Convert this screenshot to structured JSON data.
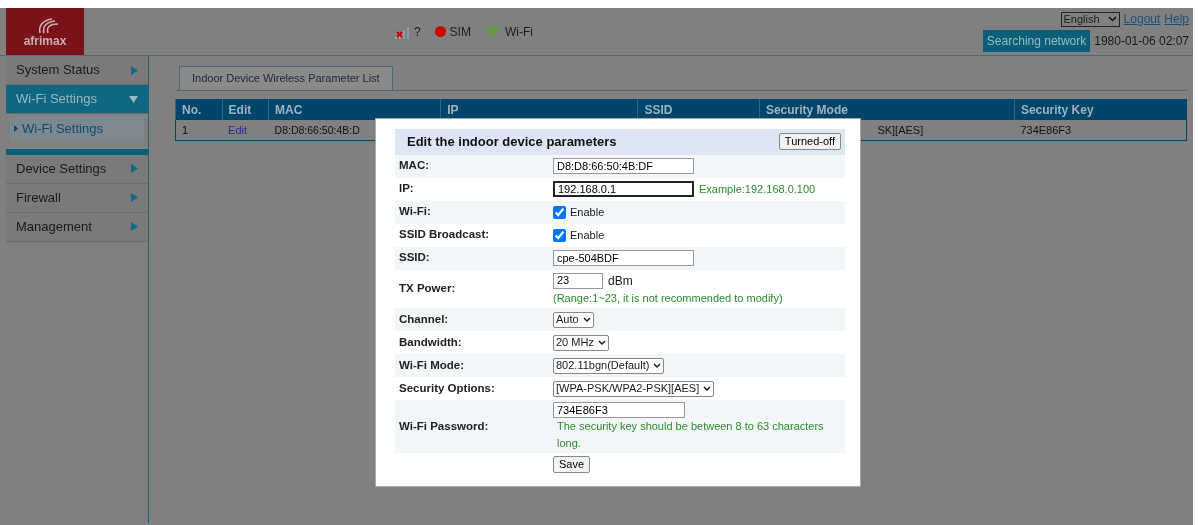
{
  "header": {
    "logo": "afrimax",
    "signal": {
      "text": "?"
    },
    "sim": {
      "text": "SIM",
      "color": "#cc0000"
    },
    "wifi": {
      "text": "Wi-Fi",
      "color": "#4caf1a"
    },
    "language": "English",
    "links": [
      "Logout",
      "Help"
    ],
    "network_status": "Searching network",
    "datetime": "1980-01-06 02:07"
  },
  "sidebar": {
    "items": [
      {
        "label": "System Status",
        "expanded": false,
        "selected": false
      },
      {
        "label": "Wi-Fi Settings",
        "expanded": true,
        "selected": true,
        "children": [
          {
            "label": "Wi-Fi Settings",
            "selected": true
          }
        ]
      },
      {
        "label": "Device Settings",
        "expanded": false,
        "selected": false
      },
      {
        "label": "Firewall",
        "expanded": false,
        "selected": false
      },
      {
        "label": "Management",
        "expanded": false,
        "selected": false
      }
    ]
  },
  "tabs": [
    {
      "label": "Indoor Device Wireless Parameter List",
      "selected": true
    }
  ],
  "table": {
    "columns": [
      "No.",
      "Edit",
      "MAC",
      "IP",
      "SSID",
      "Security Mode",
      "Security Key"
    ],
    "rows": [
      [
        "1",
        "Edit",
        "D8:D8:66:50:4B:D",
        "",
        "",
        "SK][AES]",
        "734E86F3"
      ]
    ]
  },
  "dialog": {
    "title": "Edit the indoor device parameters",
    "close_button": "Turned-off",
    "fields": [
      {
        "kind": "text",
        "label": "MAC:",
        "value": "D8:D8:66:50:4B:DF"
      },
      {
        "kind": "text",
        "label": "IP:",
        "value": "192.168.0.1",
        "focused": true,
        "hint": "Example:192.168.0.100"
      },
      {
        "kind": "checkbox",
        "label": "Wi-Fi:",
        "text": "Enable",
        "checked": true
      },
      {
        "kind": "checkbox",
        "label": "SSID Broadcast:",
        "text": "Enable",
        "checked": true
      },
      {
        "kind": "text",
        "label": "SSID:",
        "value": "cpe-504BDF"
      },
      {
        "kind": "short",
        "label": "TX Power:",
        "value": "23",
        "unit": "dBm",
        "hint": "(Range:1~23, it is not recommended to modify)"
      },
      {
        "kind": "select",
        "label": "Channel:",
        "value": "Auto"
      },
      {
        "kind": "select",
        "label": "Bandwidth:",
        "value": "20 MHz"
      },
      {
        "kind": "select",
        "label": "Wi-Fi Mode:",
        "value": "802.11bgn(Default)"
      },
      {
        "kind": "select",
        "label": "Security Options:",
        "value": "[WPA-PSK/WPA2-PSK][AES]"
      },
      {
        "kind": "password",
        "label": "Wi-Fi Password:",
        "value": "734E86F3",
        "hint": "The security key should be between 8 to 63 characters long."
      },
      {
        "kind": "button",
        "text": "Save"
      }
    ]
  }
}
